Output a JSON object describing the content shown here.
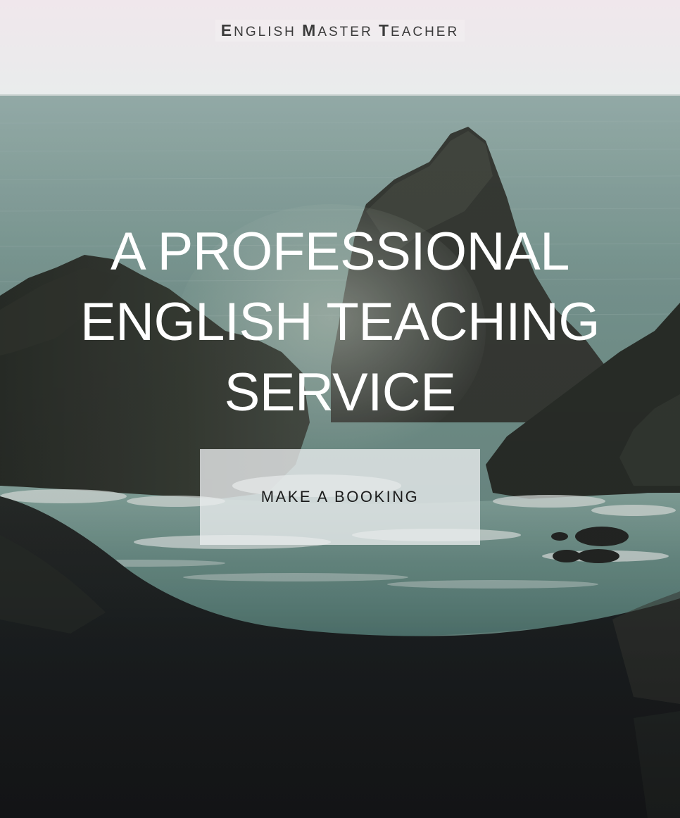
{
  "header": {
    "brand_parts": [
      "E",
      "NGLISH ",
      "M",
      "ASTER ",
      "T",
      "EACHER"
    ]
  },
  "hero": {
    "headline_lines": [
      "A PROFESSIONAL",
      "ENGLISH TEACHING",
      "SERVICE"
    ],
    "cta_label": "MAKE A BOOKING",
    "background_image": "seascape-sea-stacks-photo"
  },
  "colors": {
    "sky": "#ede6ea",
    "sea": "#7b9c96",
    "rock_dark": "#1d2022",
    "cta_bg": "#eceef0",
    "cta_text": "#1b1b1b",
    "headline_text": "#ffffff",
    "brand_text": "#3c3c3c"
  }
}
